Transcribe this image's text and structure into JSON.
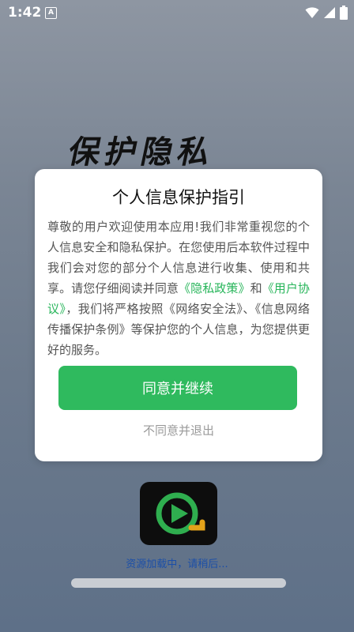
{
  "status_bar": {
    "time": "1:42",
    "notification_glyph": "A",
    "icons": [
      "wifi-icon",
      "signal-icon",
      "battery-icon"
    ]
  },
  "background_title": "保护隐私",
  "dialog": {
    "title": "个人信息保护指引",
    "body_part1": "尊敬的用户欢迎使用本应用!我们非常重视您的个人信息安全和隐私保护。在您使用后本软件过程中我们会对您的部分个人信息进行收集、使用和共享。请您仔细阅读并同意",
    "privacy_policy_link": "《隐私政策》",
    "body_and": "和",
    "user_agreement_link": "《用户协议》",
    "body_part2": "，我们将严格按照《网络安全法》、《信息网络传播保护条例》等保护您的个人信息，为您提供更好的服务。",
    "agree_label": "同意并继续",
    "reject_label": "不同意并退出"
  },
  "loading": {
    "text": "资源加载中，请稍后..."
  },
  "colors": {
    "accent_green": "#2fba5e",
    "link_green": "#27b55a",
    "loading_text_blue": "#1c4fa8"
  }
}
